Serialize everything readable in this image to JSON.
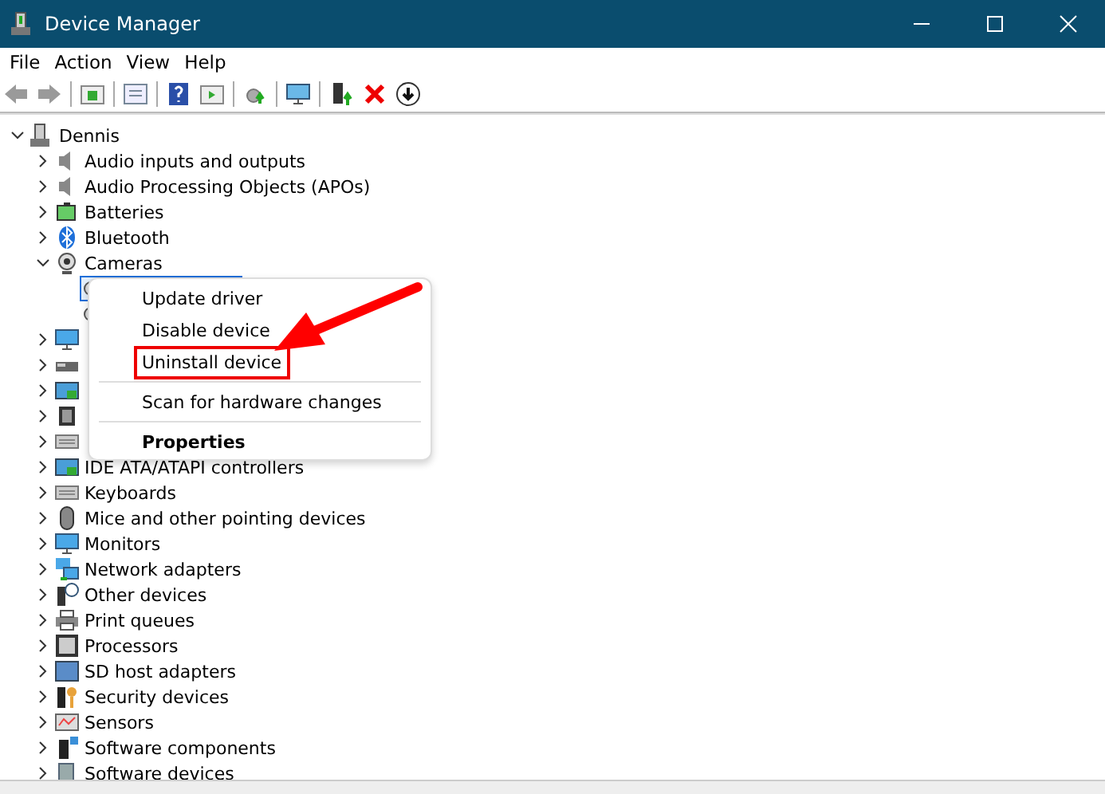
{
  "window": {
    "title": "Device Manager"
  },
  "menu_bar": [
    "File",
    "Action",
    "View",
    "Help"
  ],
  "tree": {
    "label": "Dennis",
    "expanded": true,
    "children": [
      {
        "label": "Audio inputs and outputs",
        "expanded": false
      },
      {
        "label": "Audio Processing Objects (APOs)",
        "expanded": false
      },
      {
        "label": "Batteries",
        "expanded": false
      },
      {
        "label": "Bluetooth",
        "expanded": false
      },
      {
        "label": "Cameras",
        "expanded": true,
        "children": [
          {
            "selected": true
          },
          {
            "selected": false
          }
        ]
      },
      {
        "expanded": false
      },
      {
        "expanded": false
      },
      {
        "expanded": false
      },
      {
        "expanded": false
      },
      {
        "expanded": false
      },
      {
        "label": "IDE ATA/ATAPI controllers",
        "expanded": false
      },
      {
        "label": "Keyboards",
        "expanded": false
      },
      {
        "label": "Mice and other pointing devices",
        "expanded": false
      },
      {
        "label": "Monitors",
        "expanded": false
      },
      {
        "label": "Network adapters",
        "expanded": false
      },
      {
        "label": "Other devices",
        "expanded": false
      },
      {
        "label": "Print queues",
        "expanded": false
      },
      {
        "label": "Processors",
        "expanded": false
      },
      {
        "label": "SD host adapters",
        "expanded": false
      },
      {
        "label": "Security devices",
        "expanded": false
      },
      {
        "label": "Sensors",
        "expanded": false
      },
      {
        "label": "Software components",
        "expanded": false
      },
      {
        "label": "Software devices",
        "expanded": false
      }
    ]
  },
  "context_menu": {
    "items": [
      {
        "kind": "item",
        "label": "Update driver",
        "highlighted": false,
        "default": false
      },
      {
        "kind": "item",
        "label": "Disable device",
        "highlighted": false,
        "default": false
      },
      {
        "kind": "item",
        "label": "Uninstall device",
        "highlighted": true,
        "default": false
      },
      {
        "kind": "separator"
      },
      {
        "kind": "item",
        "label": "Scan for hardware changes",
        "highlighted": false,
        "default": false
      },
      {
        "kind": "separator"
      },
      {
        "kind": "item",
        "label": "Properties",
        "highlighted": false,
        "default": true
      }
    ]
  }
}
